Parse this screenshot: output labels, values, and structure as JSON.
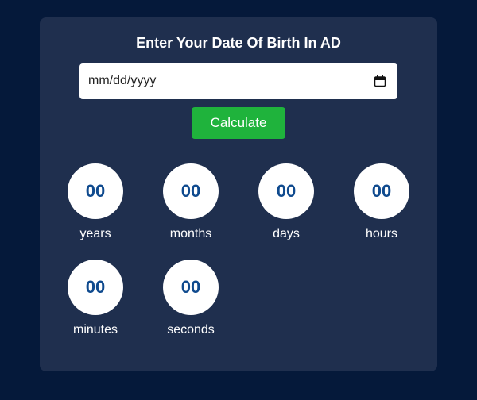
{
  "card": {
    "title": "Enter Your Date Of Birth In AD"
  },
  "date_input": {
    "placeholder": "mm/dd/yyyy",
    "icon": "calendar-icon"
  },
  "calculate_button": {
    "label": "Calculate",
    "color": "#1fb33c"
  },
  "counters": [
    {
      "value": "00",
      "label": "years"
    },
    {
      "value": "00",
      "label": "months"
    },
    {
      "value": "00",
      "label": "days"
    },
    {
      "value": "00",
      "label": "hours"
    },
    {
      "value": "00",
      "label": "minutes"
    },
    {
      "value": "00",
      "label": "seconds"
    }
  ],
  "colors": {
    "background": "#05193a",
    "card": "#1f2f4e",
    "counter_text": "#0f4a8e"
  }
}
